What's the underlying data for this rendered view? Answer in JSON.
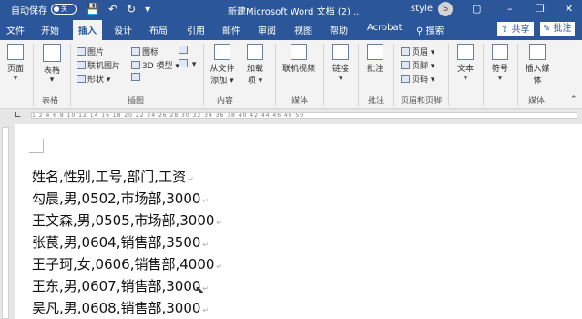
{
  "titlebar": {
    "autosave_label": "自动保存",
    "autosave_toggle": "关",
    "doc_title": "新建Microsoft Word 文档 (2)...",
    "user_name": "style",
    "avatar_initial": "S",
    "minimize": "–",
    "restore": "❐",
    "close": "✕",
    "options": "▢"
  },
  "tabs": [
    "文件",
    "开始",
    "插入",
    "设计",
    "布局",
    "引用",
    "邮件",
    "审阅",
    "视图",
    "帮助",
    "Acrobat"
  ],
  "search_label": "搜索",
  "share_label": "共享",
  "comment_label": "批注",
  "ribbon": {
    "page_label": "页面",
    "table_label": "表格",
    "table_group": "表格",
    "picture": "图片",
    "online_picture": "联机图片",
    "shapes": "形状",
    "icons": "图标",
    "model3d": "3D 模型",
    "illustrations_group": "插图",
    "from_file": "从文件添加",
    "addins": "加载项",
    "content_group": "内容",
    "online_video": "联机视频",
    "media_group": "媒体",
    "link": "链接",
    "comment": "批注",
    "comment_group": "批注",
    "header": "页眉",
    "footer": "页脚",
    "page_number": "页码",
    "header_footer_group": "页眉和页脚",
    "text": "文本",
    "symbol": "符号",
    "insert_media": "插入媒体",
    "media_group2": "媒体"
  },
  "ruler_text": "1  2  4  6  8  10  12  14  16  18  20  22  24  26  28  30  32  34  36  38  40  42  44  46  48  50",
  "document": {
    "lines": [
      "姓名,性别,工号,部门,工资",
      "勾晨,男,0502,市场部,3000",
      "王文森,男,0505,市场部,3000",
      "张茛,男,0604,销售部,3500",
      "王子珂,女,0606,销售部,4000",
      "王东,男,0607,销售部,3000",
      "吴凡,男,0608,销售部,3000"
    ],
    "paragraph_mark": "↵"
  }
}
